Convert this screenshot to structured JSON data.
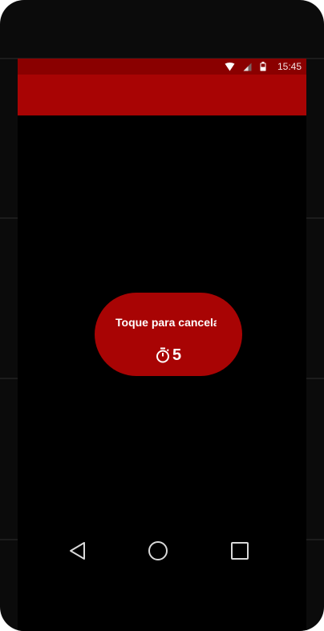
{
  "status_bar": {
    "time": "15:45",
    "icons": [
      "wifi-icon",
      "cell-signal-icon",
      "battery-icon"
    ],
    "color": "#8a0000"
  },
  "toolbar": {
    "color": "#a80404"
  },
  "cancel_pill": {
    "label": "Toque para cancelar",
    "countdown": "5",
    "icon": "stopwatch-icon",
    "color": "#a80404"
  },
  "navigation": {
    "buttons": [
      "back-icon",
      "home-icon",
      "recents-icon"
    ]
  }
}
